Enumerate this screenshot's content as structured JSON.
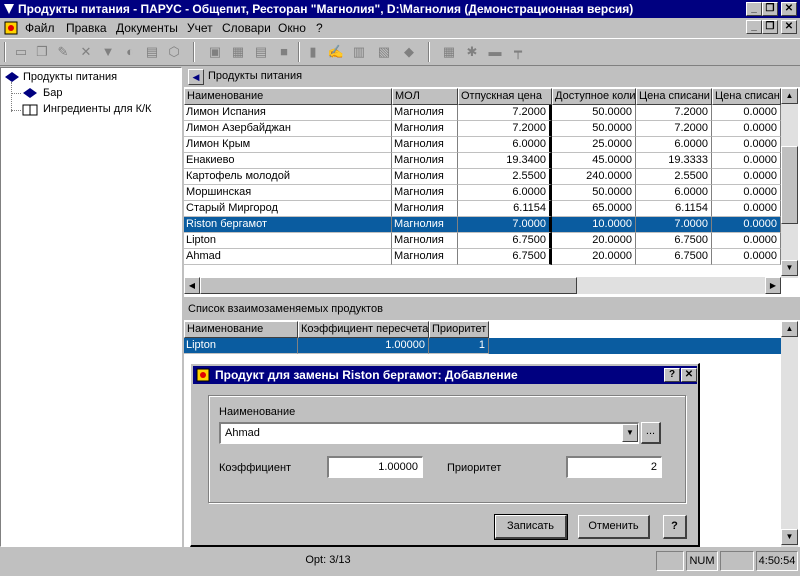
{
  "window": {
    "title": "Продукты питания - ПАРУС - Общепит, Ресторан \"Магнолия\", D:\\Магнолия (Демонстрационная версия)",
    "caption_buttons": [
      "_",
      "❐",
      "✕"
    ]
  },
  "menu": {
    "items": [
      "Файл",
      "Правка",
      "Документы",
      "Учет",
      "Словари",
      "Окно",
      "?"
    ],
    "mdi_buttons": [
      "_",
      "❐",
      "✕"
    ]
  },
  "tree": {
    "root": "Продукты питания",
    "children": [
      "Бар",
      "Ингредиенты для К/К"
    ]
  },
  "products_panel": {
    "title": "Продукты питания",
    "columns": [
      "Наименование",
      "МОЛ",
      "Отпускная цена",
      "Доступное коли",
      "Цена списани",
      "Цена списан"
    ],
    "rows": [
      [
        "Лимон Испания",
        "Магнолия",
        "7.2000",
        "50.0000",
        "7.2000",
        "0.0000"
      ],
      [
        "Лимон Азербайджан",
        "Магнолия",
        "7.2000",
        "50.0000",
        "7.2000",
        "0.0000"
      ],
      [
        "Лимон Крым",
        "Магнолия",
        "6.0000",
        "25.0000",
        "6.0000",
        "0.0000"
      ],
      [
        "Енакиево",
        "Магнолия",
        "19.3400",
        "45.0000",
        "19.3333",
        "0.0000"
      ],
      [
        "Картофель молодой",
        "Магнолия",
        "2.5500",
        "240.0000",
        "2.5500",
        "0.0000"
      ],
      [
        "Моршинская",
        "Магнолия",
        "6.0000",
        "50.0000",
        "6.0000",
        "0.0000"
      ],
      [
        "Старый Миргород",
        "Магнолия",
        "6.1154",
        "65.0000",
        "6.1154",
        "0.0000"
      ],
      [
        "Riston бергамот",
        "Магнолия",
        "7.0000",
        "10.0000",
        "7.0000",
        "0.0000"
      ],
      [
        "Lipton",
        "Магнолия",
        "6.7500",
        "20.0000",
        "6.7500",
        "0.0000"
      ],
      [
        "Ahmad",
        "Магнолия",
        "6.7500",
        "20.0000",
        "6.7500",
        "0.0000"
      ]
    ],
    "selected_row": 7
  },
  "substitutes_panel": {
    "title": "Список взаимозаменяемых продуктов",
    "columns": [
      "Наименование",
      "Коэффициент пересчета",
      "Приоритет"
    ],
    "rows": [
      [
        "Lipton",
        "1.00000",
        "1"
      ]
    ]
  },
  "dialog": {
    "title": "Продукт для замены Riston бергамот: Добавление",
    "name_label": "Наименование",
    "name_value": "Ahmad",
    "browse_label": "...",
    "coef_label": "Коэффициент",
    "coef_value": "1.00000",
    "priority_label": "Приоритет",
    "priority_value": "2",
    "save_label": "Записать",
    "cancel_label": "Отменить",
    "help_label": "?"
  },
  "statusbar": {
    "record": "Орt: 3/13",
    "num": "NUM",
    "time": "4:50:54"
  },
  "colors": {
    "titlebar": "#000080",
    "selection": "#0a5ca0",
    "face": "#c0c0c0"
  }
}
